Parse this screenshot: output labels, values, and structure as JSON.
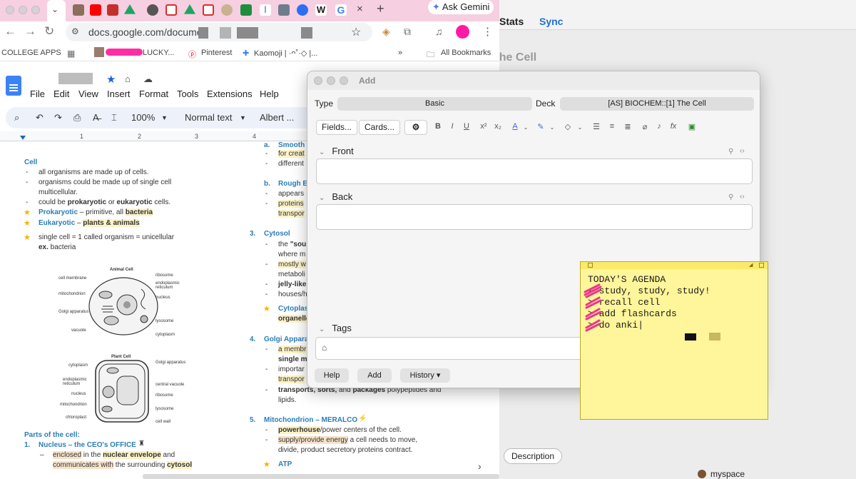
{
  "browser": {
    "tab_close": "×",
    "new_tab": "+",
    "gemini": "Ask Gemini",
    "url": "docs.google.com/documen",
    "bookmarks": [
      "COLLEGE APPS",
      "LUCKY...",
      "Pinterest",
      "Kaomoji | ·ᴖ˚·◇ |...",
      "All Bookmarks"
    ]
  },
  "docs": {
    "menu": [
      "File",
      "Edit",
      "View",
      "Insert",
      "Format",
      "Tools",
      "Extensions",
      "Help"
    ],
    "zoom": "100%",
    "style": "Normal text",
    "font": "Albert ...",
    "ruler": [
      "1",
      "2",
      "3",
      "4"
    ],
    "left": {
      "heading": "Cell",
      "b1": "all organisms are made up of cells.",
      "b2a": "organisms could be made up of single cell",
      "b2b": "multicellular.",
      "b3_pre": "could be ",
      "b3_p": "prokaryotic",
      "b3_mid": " or ",
      "b3_e": "eukaryotic",
      "b3_post": " cells.",
      "s1_term": "Prokaryotic",
      "s1_mid": " – primitive, all ",
      "s1_b": "bacteria",
      "s2_term": "Eukaryotic",
      "s2_mid": " – ",
      "s2_b": "plants & animals",
      "s3": "single cell = 1 called organism = unicellular",
      "s3b_b": "ex.",
      "s3b": " bacteria",
      "fig1_title": "Animal Cell",
      "fig1_labels": [
        "cell membrane",
        "mitochondrion",
        "Golgi apparatus",
        "vacuole",
        "ribosome",
        "endoplasmic reticulum",
        "nucleus",
        "lysosome",
        "cytoplasm"
      ],
      "fig2_title": "Plant Cell",
      "fig2_labels": [
        "cytoplasm",
        "endoplasmic reticulum",
        "nucleus",
        "mitochondrion",
        "chloroplast",
        "Golgi apparatus",
        "central vacuole",
        "ribosome",
        "lysosome",
        "cell wall"
      ],
      "parts": "Parts of the cell:",
      "n1_num": "1.",
      "n1": "Nucleus – the CEO's OFFICE",
      "n1a_pre": "enclosed",
      "n1a_mid": " in the ",
      "n1a_b": "nuclear envelope",
      "n1a_post": " and",
      "n1b_pre": "communicates with",
      "n1b_mid": " the surrounding ",
      "n1b_b": "cytosol"
    },
    "right": {
      "a": "a.",
      "a_title": "Smooth",
      "a1": "for creat",
      "a2": "different",
      "b": "b.",
      "b_title": "Rough E",
      "b1": "appears",
      "b2": "proteins",
      "b3": "transpor",
      "n3": "3.",
      "cyto": "Cytosol",
      "c1a": "the ",
      "c1b": "\"sou",
      "c2": "where m",
      "c3": "mostly w",
      "c4": "metaboli",
      "c5": "jelly-like",
      "c6": "houses/h",
      "cstar": "Cytoplas",
      "cstar2": "organelle",
      "n4": "4.",
      "golgi": "Golgi Appara",
      "g1": "a membr",
      "g2": "single m",
      "g3": "importar",
      "g4": "transpor",
      "g5_b": "transports, sorts,",
      "g5_mid": " and ",
      "g5_b2": "packages",
      "g5_post": " polypeptides and",
      "g6": "lipids.",
      "n5": "5.",
      "mito": "Mitochondrion – MERALCO",
      "m1_b": "powerhouse",
      "m1": "/power centers of the cell.",
      "m2_h": "supply/provide energy",
      "m2": " a cell needs to move,",
      "m3": "divide, product secretory proteins contract.",
      "atp": "ATP"
    }
  },
  "anki_main": {
    "stats": "Stats",
    "sync": "Sync",
    "deck_heading": "The Cell",
    "description": "Description",
    "myspace": "myspace"
  },
  "add_dialog": {
    "title": "Add",
    "type_label": "Type",
    "type_value": "Basic",
    "deck_label": "Deck",
    "deck_value": "[AS] BIOCHEM::[1] The Cell",
    "fields_btn": "Fields...",
    "cards_btn": "Cards...",
    "front": "Front",
    "back": "Back",
    "tags": "Tags",
    "help": "Help",
    "add": "Add",
    "history": "History ▾",
    "accent": "#3b6fd6"
  },
  "sticky": {
    "lines": [
      "TODAY'S AGENDA",
      "- study, study, study!",
      "  > recall cell",
      "  > add flashcards",
      "  > do anki|"
    ],
    "scribble_color": "#e8388c"
  }
}
